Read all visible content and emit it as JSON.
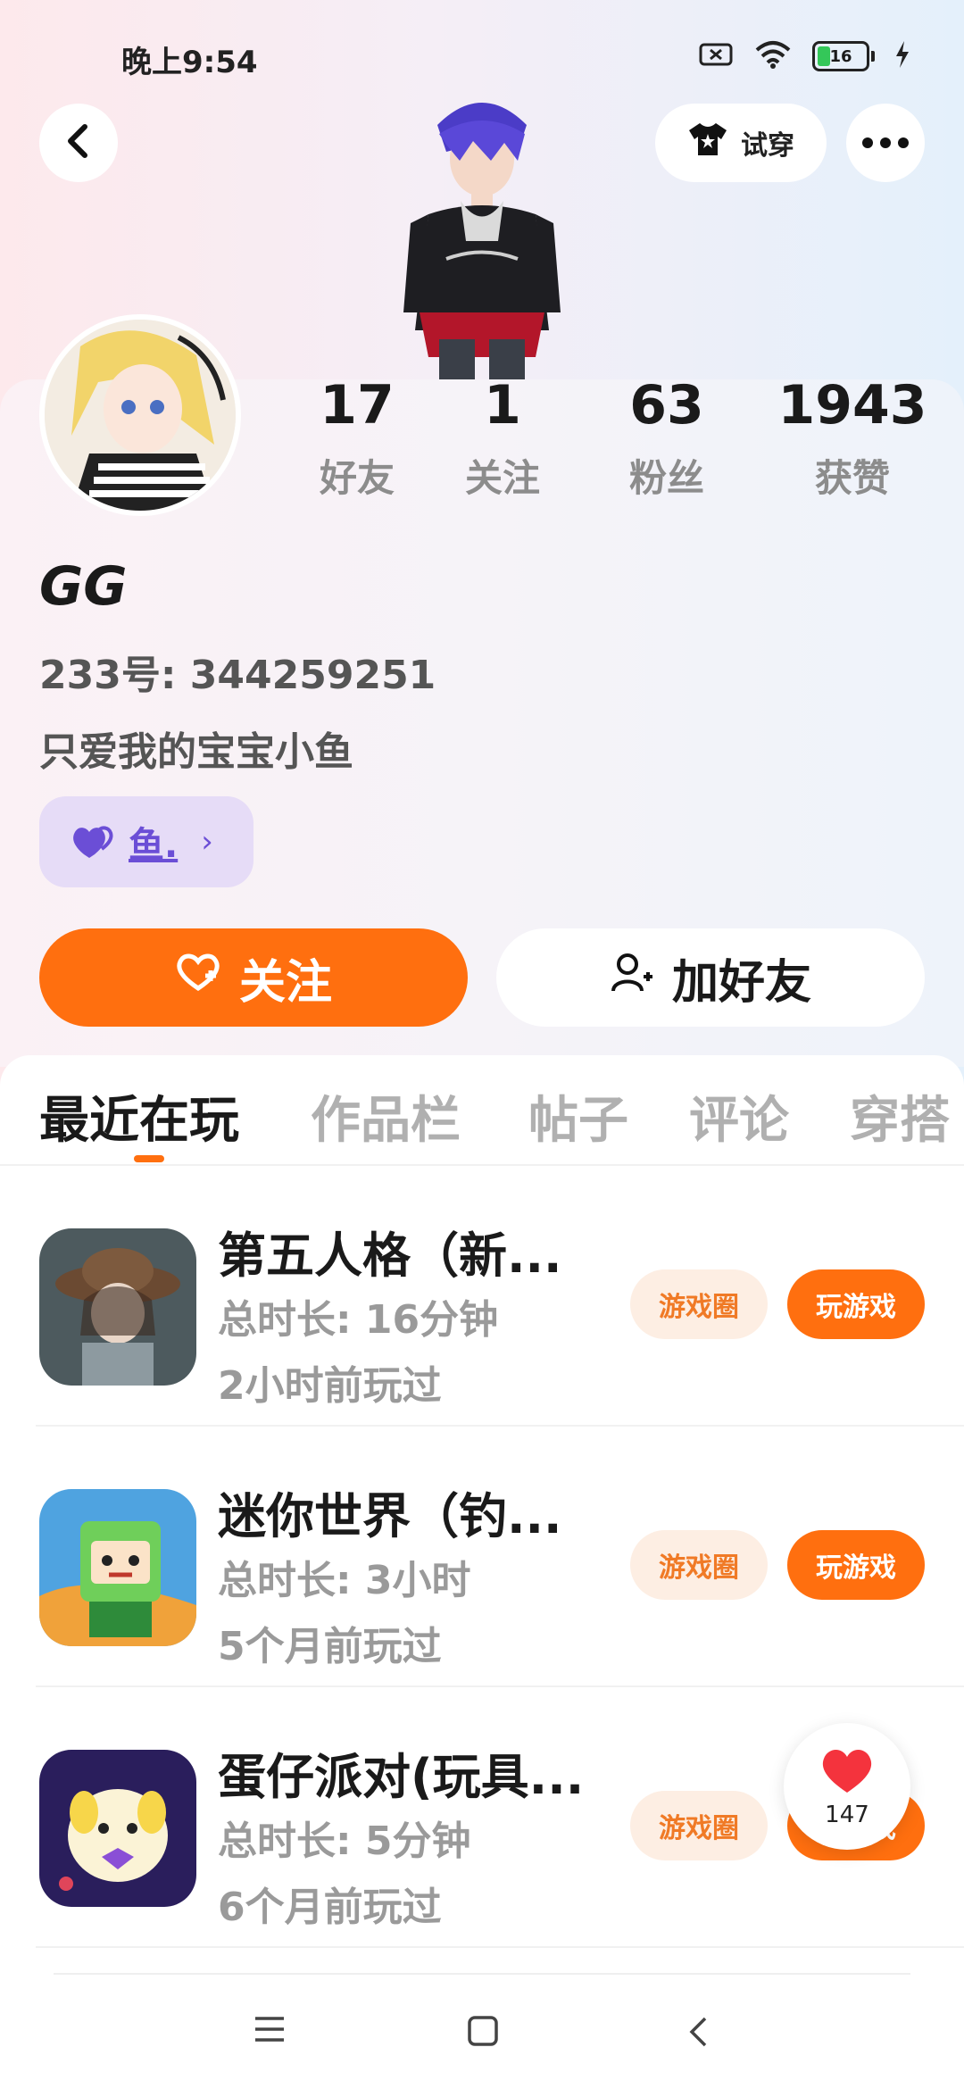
{
  "status_bar": {
    "time": "晚上9:54",
    "battery": "16"
  },
  "header": {
    "tryon_label": "试穿"
  },
  "stats": [
    {
      "value": "17",
      "label": "好友"
    },
    {
      "value": "1",
      "label": "关注"
    },
    {
      "value": "63",
      "label": "粉丝"
    },
    {
      "value": "1943",
      "label": "获赞"
    }
  ],
  "profile": {
    "name": "GG",
    "id_line": "233号: 344259251",
    "bio": "只爱我的宝宝小鱼",
    "tag": "鱼."
  },
  "actions": {
    "follow": "关注",
    "add_friend": "加好友"
  },
  "tabs": [
    "最近在玩",
    "作品栏",
    "帖子",
    "评论",
    "穿搭"
  ],
  "games": [
    {
      "title": "第五人格（新...",
      "duration": "总时长: 16分钟",
      "last_played": "2小时前玩过",
      "circle": "游戏圈",
      "play": "玩游戏"
    },
    {
      "title": "迷你世界（钓...",
      "duration": "总时长: 3小时",
      "last_played": "5个月前玩过",
      "circle": "游戏圈",
      "play": "玩游戏"
    },
    {
      "title": "蛋仔派对(玩具...",
      "duration": "总时长: 5分钟",
      "last_played": "6个月前玩过",
      "circle": "游戏圈",
      "play": "玩游戏"
    }
  ],
  "like_float": {
    "count": "147"
  },
  "colors": {
    "accent": "#ff6f0f",
    "chip_bg": "#fdeee3",
    "tag_bg": "#e6dcf7",
    "tag_text": "#6b4ed6"
  }
}
